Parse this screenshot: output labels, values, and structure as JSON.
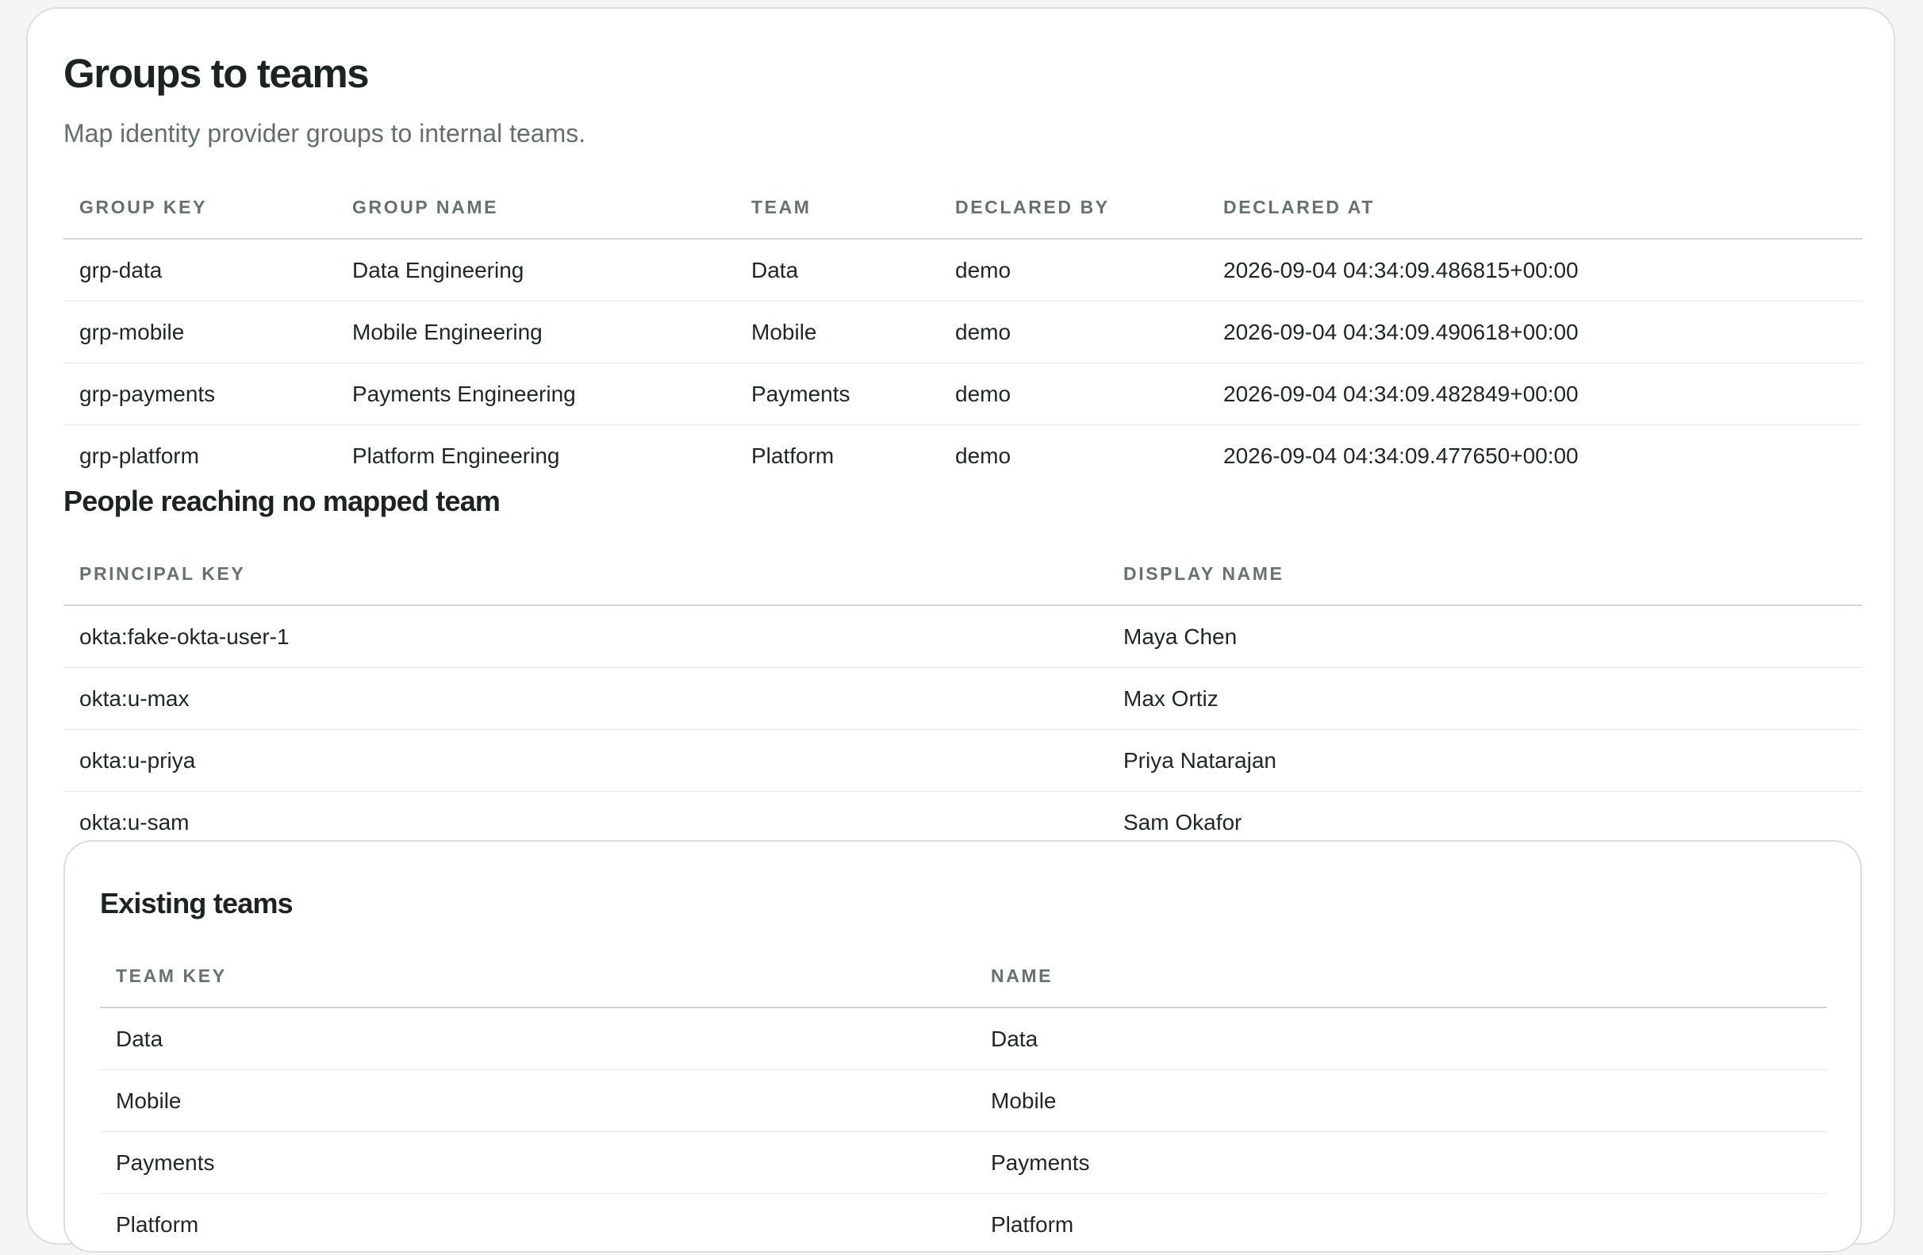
{
  "page": {
    "title": "Groups to teams",
    "subtitle": "Map identity provider groups to internal teams."
  },
  "group_mappings": {
    "columns": [
      "Group key",
      "Group name",
      "Team",
      "Declared by",
      "Declared at"
    ],
    "rows": [
      [
        "grp-data",
        "Data Engineering",
        "Data",
        "demo",
        "2026-09-04 04:34:09.486815+00:00"
      ],
      [
        "grp-mobile",
        "Mobile Engineering",
        "Mobile",
        "demo",
        "2026-09-04 04:34:09.490618+00:00"
      ],
      [
        "grp-payments",
        "Payments Engineering",
        "Payments",
        "demo",
        "2026-09-04 04:34:09.482849+00:00"
      ],
      [
        "grp-platform",
        "Platform Engineering",
        "Platform",
        "demo",
        "2026-09-04 04:34:09.477650+00:00"
      ]
    ]
  },
  "unmapped_people": {
    "title": "People reaching no mapped team",
    "columns": [
      "Principal key",
      "Display name"
    ],
    "rows": [
      [
        "okta:fake-okta-user-1",
        "Maya Chen"
      ],
      [
        "okta:u-max",
        "Max Ortiz"
      ],
      [
        "okta:u-priya",
        "Priya Natarajan"
      ],
      [
        "okta:u-sam",
        "Sam Okafor"
      ]
    ]
  },
  "existing_teams": {
    "title": "Existing teams",
    "columns": [
      "Team key",
      "Name"
    ],
    "rows": [
      [
        "Data",
        "Data"
      ],
      [
        "Mobile",
        "Mobile"
      ],
      [
        "Payments",
        "Payments"
      ],
      [
        "Platform",
        "Platform"
      ]
    ]
  }
}
